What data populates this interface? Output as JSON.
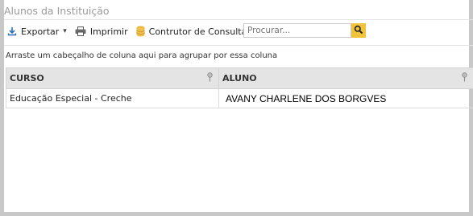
{
  "window": {
    "title": "Alunos da Instituição"
  },
  "toolbar": {
    "export_label": "Exportar",
    "print_label": "Imprimir",
    "query_builder_label": "Contrutor de Consultas",
    "search_placeholder": "Procurar...",
    "search_value": ""
  },
  "group_panel": {
    "text": "Arraste um cabeçalho de coluna aqui para agrupar por essa coluna"
  },
  "grid": {
    "columns": [
      "CURSO",
      "ALUNO"
    ],
    "rows": [
      [
        "Educação Especial - Creche",
        "AVANY CHARLENE DOS BORGVES"
      ]
    ]
  },
  "colors": {
    "search_button": "#f1c33a",
    "header_bg": "#e4e4e4",
    "frame": "#c8c8c8"
  },
  "icons": [
    "download-icon",
    "printer-icon",
    "database-icon",
    "magnifier-icon",
    "pin-icon"
  ]
}
